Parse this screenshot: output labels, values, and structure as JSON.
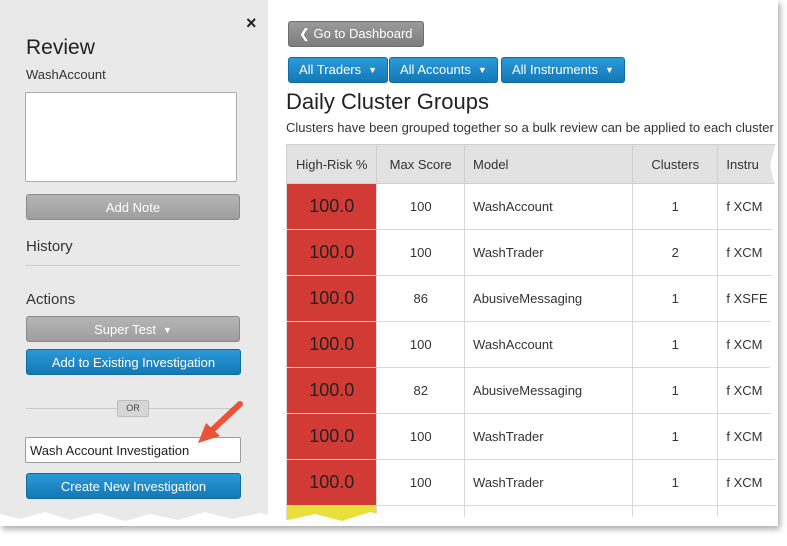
{
  "sidebar": {
    "title": "Review",
    "model_name": "WashAccount",
    "note_value": "",
    "add_note_label": "Add Note",
    "history_heading": "History",
    "actions_heading": "Actions",
    "action_dropdown_label": "Super Test",
    "add_existing_label": "Add to Existing Investigation",
    "or_label": "OR",
    "new_investigation_name": "Wash Account Investigation",
    "create_new_label": "Create New Investigation",
    "close_icon": "×"
  },
  "main": {
    "back_label": "Go to Dashboard",
    "filters": [
      {
        "label": "All Traders"
      },
      {
        "label": "All Accounts"
      },
      {
        "label": "All Instruments"
      }
    ],
    "title": "Daily Cluster Groups",
    "description": "Clusters have been grouped together so a bulk review can be applied to each cluster",
    "table": {
      "headers": [
        "High-Risk %",
        "Max Score",
        "Model",
        "Clusters",
        "Instru"
      ],
      "rows": [
        {
          "risk": "100.0",
          "max_score": "100",
          "model": "WashAccount",
          "clusters": "1",
          "instrument": "f XCM"
        },
        {
          "risk": "100.0",
          "max_score": "100",
          "model": "WashTrader",
          "clusters": "2",
          "instrument": "f XCM"
        },
        {
          "risk": "100.0",
          "max_score": "86",
          "model": "AbusiveMessaging",
          "clusters": "1",
          "instrument": "f XSFE"
        },
        {
          "risk": "100.0",
          "max_score": "100",
          "model": "WashAccount",
          "clusters": "1",
          "instrument": "f XCM"
        },
        {
          "risk": "100.0",
          "max_score": "82",
          "model": "AbusiveMessaging",
          "clusters": "1",
          "instrument": "f XCM"
        },
        {
          "risk": "100.0",
          "max_score": "100",
          "model": "WashTrader",
          "clusters": "1",
          "instrument": "f XCM"
        },
        {
          "risk": "100.0",
          "max_score": "100",
          "model": "WashTrader",
          "clusters": "1",
          "instrument": "f XCM"
        }
      ]
    }
  },
  "colors": {
    "high_risk": "#d23b35",
    "medium_risk": "#e8df3a",
    "primary_button": "#1a86c8",
    "annotation_arrow": "#e8533a"
  }
}
